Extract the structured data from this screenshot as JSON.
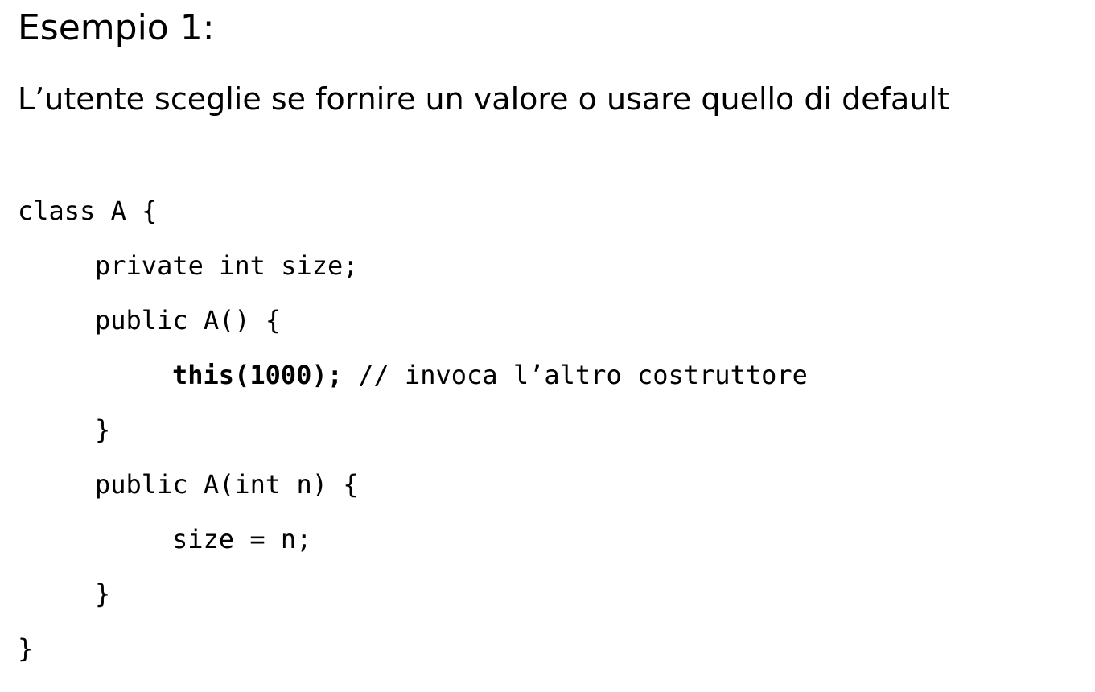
{
  "slide": {
    "title": "Esempio 1:",
    "subtitle": "L’utente sceglie se fornire un valore o usare quello di default"
  },
  "code": {
    "line1": "class A {",
    "line2": "private int size;",
    "line3": "public A() {",
    "line4_bold": "this(1000);",
    "line4_rest": " // invoca l’altro costruttore",
    "line5": "}",
    "line6": "public A(int n) {",
    "line7": "size = n;",
    "line8": "}",
    "line9": "}"
  }
}
